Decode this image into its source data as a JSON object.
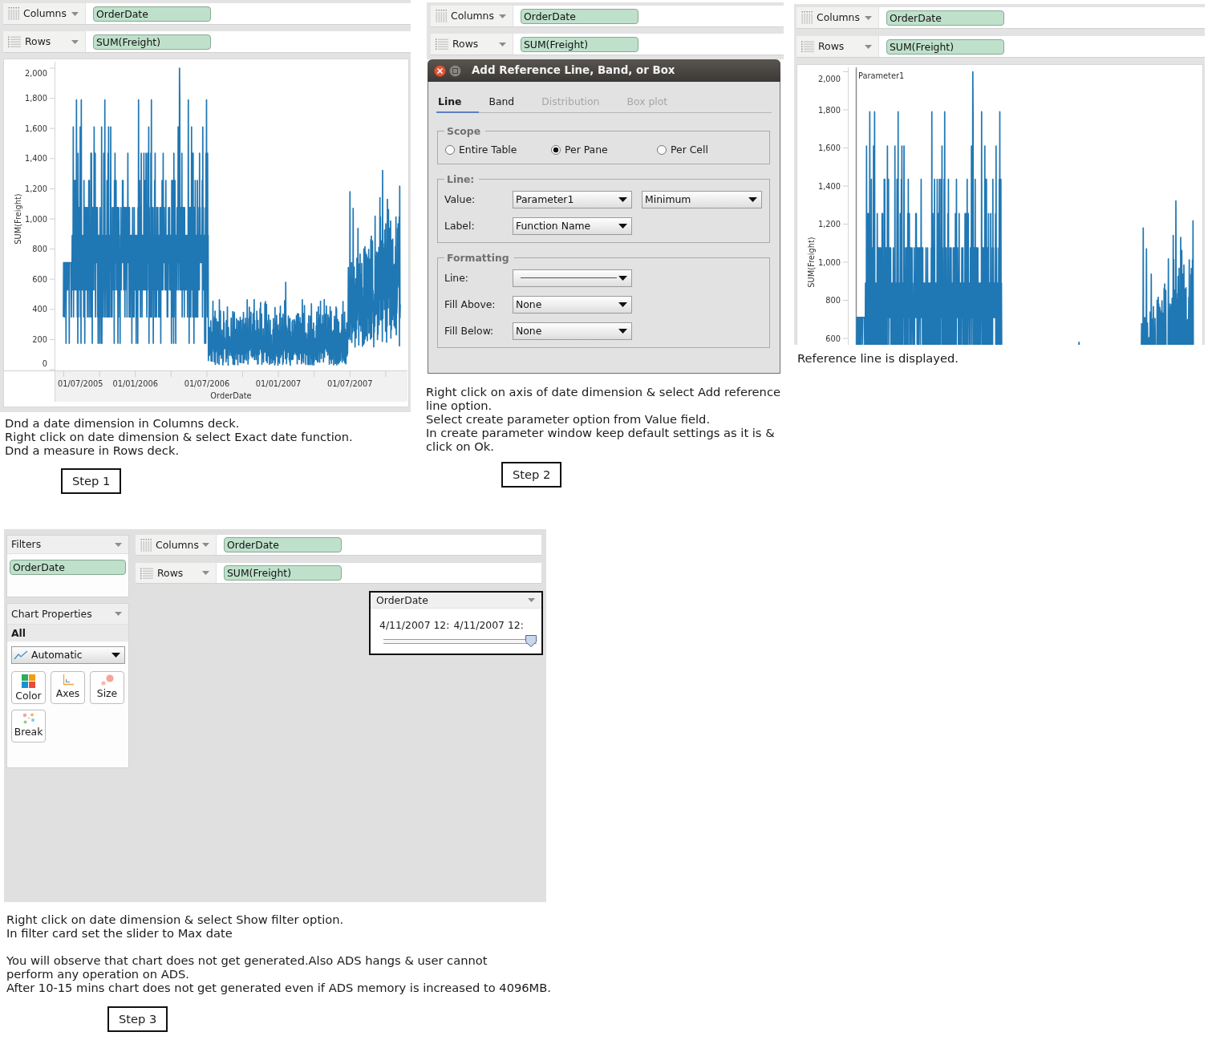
{
  "panels": [
    {
      "kind": "chart_view",
      "shelves": [
        {
          "kind": "columns",
          "label": "Columns",
          "pill": "OrderDate"
        },
        {
          "kind": "rows",
          "label": "Rows",
          "pill": "SUM(Freight)"
        }
      ],
      "chart": {
        "y_title": "SUM(Freight)",
        "y_ticks": [
          "2,000",
          "1,800",
          "1,600",
          "1,400",
          "1,200",
          "1,000",
          "800",
          "600",
          "400",
          "200",
          "0"
        ],
        "x_ticks": [
          "01/07/2005",
          "01/01/2006",
          "01/07/2006",
          "01/01/2007",
          "01/07/2007"
        ],
        "x_title": "OrderDate"
      },
      "caption": [
        [
          "Dnd a date dimension in Columns deck.",
          "Right click on date dimension & select Exact date function.",
          "Dnd a measure in Rows deck."
        ]
      ],
      "step": "Step 1"
    },
    {
      "kind": "dialog_view",
      "shelves": [
        {
          "kind": "columns",
          "label": "Columns",
          "pill": "OrderDate"
        },
        {
          "kind": "rows",
          "label": "Rows",
          "pill": "SUM(Freight)"
        }
      ],
      "dialog": {
        "title": "Add Reference Line, Band, or Box",
        "tabs": [
          {
            "label": "Line",
            "selected": true,
            "disabled": false
          },
          {
            "label": "Band",
            "selected": false,
            "disabled": false
          },
          {
            "label": "Distribution",
            "selected": false,
            "disabled": true
          },
          {
            "label": "Box plot",
            "selected": false,
            "disabled": true
          }
        ],
        "groups": [
          {
            "kind": "radios",
            "legend": "Scope",
            "options": [
              {
                "label": "Entire Table",
                "selected": false
              },
              {
                "label": "Per Pane",
                "selected": true
              },
              {
                "label": "Per Cell",
                "selected": false
              }
            ]
          },
          {
            "kind": "fields",
            "legend": "Line:",
            "rows": [
              {
                "label": "Value:",
                "selects": [
                  {
                    "kind": "text",
                    "value": "Parameter1"
                  },
                  {
                    "kind": "text",
                    "value": "Minimum"
                  }
                ]
              },
              {
                "label": "Label:",
                "selects": [
                  {
                    "kind": "text",
                    "value": "Function Name"
                  }
                ]
              }
            ]
          },
          {
            "kind": "fields",
            "legend": "Formatting",
            "rows": [
              {
                "label": "Line:",
                "selects": [
                  {
                    "kind": "line_style"
                  }
                ]
              },
              {
                "label": "Fill Above:",
                "selects": [
                  {
                    "kind": "text",
                    "value": "None"
                  }
                ]
              },
              {
                "label": "Fill Below:",
                "selects": [
                  {
                    "kind": "text",
                    "value": "None"
                  }
                ]
              }
            ]
          }
        ]
      },
      "caption": [
        [
          "Right click on axis of date dimension & select Add reference line option.",
          "Select create parameter option from Value field.",
          "In create parameter window keep default settings as it is & click on Ok."
        ]
      ],
      "step": "Step 2"
    },
    {
      "kind": "chart_view",
      "shelves": [
        {
          "kind": "columns",
          "label": "Columns",
          "pill": "OrderDate"
        },
        {
          "kind": "rows",
          "label": "Rows",
          "pill": "SUM(Freight)"
        }
      ],
      "chart": {
        "y_title": "SUM(Freight)",
        "y_ticks": [
          "2,000",
          "1,800",
          "1,600",
          "1,400",
          "1,200",
          "1,000",
          "800",
          "600"
        ],
        "reference_line": "Parameter1"
      },
      "caption": [
        [
          "Reference line is displayed."
        ]
      ]
    },
    {
      "kind": "workspace_view",
      "filters": {
        "title": "Filters",
        "pills": [
          "OrderDate"
        ]
      },
      "chart_properties": {
        "title": "Chart Properties",
        "section": "All",
        "chart_type": "Automatic",
        "buttons": [
          {
            "kind": "color",
            "label": "Color"
          },
          {
            "kind": "axes",
            "label": "Axes"
          },
          {
            "kind": "size",
            "label": "Size"
          },
          {
            "kind": "break",
            "label": "Break"
          }
        ]
      },
      "shelves": [
        {
          "kind": "columns",
          "label": "Columns",
          "pill": "OrderDate"
        },
        {
          "kind": "rows",
          "label": "Rows",
          "pill": "SUM(Freight)"
        }
      ],
      "filter_card": {
        "title": "OrderDate",
        "range": [
          "4/11/2007 12:",
          "4/11/2007 12:"
        ],
        "slider": {
          "level": 1
        }
      },
      "caption": [
        [
          "Right click on date dimension & select Show filter option.",
          "In filter card set the slider to Max date"
        ],
        [
          "You will observe that chart does not get generated.Also ADS hangs & user cannot",
          "perform any operation on ADS.",
          "After 10-15 mins chart does not get generated even if ADS memory is increased to 4096MB."
        ]
      ],
      "step": "Step 3"
    }
  ]
}
